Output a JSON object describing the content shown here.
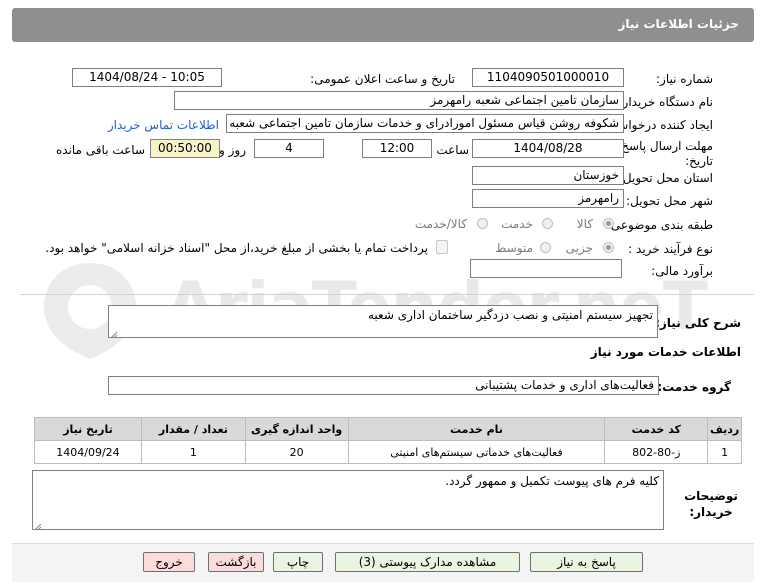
{
  "header": {
    "title": "جزئیات اطلاعات نیاز"
  },
  "watermark": "AriaTender.neT",
  "fields": {
    "need_number": {
      "label": "شماره نیاز:",
      "value": "1104090501000010"
    },
    "announce": {
      "label": "تاریخ و ساعت اعلان عمومی:",
      "value": "1404/08/24 - 10:05"
    },
    "buyer_org": {
      "label": "نام دستگاه خریدار:",
      "value": "سازمان تامین اجتماعی شعبه رامهرمز"
    },
    "requester": {
      "label": "ایجاد کننده درخواست:",
      "value": "شکوفه روشن قیاس مسئول امورادرای و خدمات سازمان تامین اجتماعی شعبه ر",
      "contact_link": "اطلاعات تماس خریدار"
    },
    "deadline": {
      "label": "مهلت ارسال پاسخ: تا تاریخ:",
      "date": "1404/08/28",
      "time_label": "ساعت",
      "time": "12:00",
      "days": "4",
      "days_label": "روز و",
      "remaining": "00:50:00",
      "remaining_label": "ساعت باقی مانده"
    },
    "province": {
      "label": "استان محل تحویل:",
      "value": "خوزستان"
    },
    "city": {
      "label": "شهر محل تحویل:",
      "value": "رامهرمز"
    },
    "category": {
      "label": "طبقه بندی موضوعی:",
      "options": [
        "کالا",
        "خدمت",
        "کالا/خدمت"
      ],
      "selected": "کالا"
    },
    "purchase_type": {
      "label": "نوع فرآیند خرید :",
      "options": [
        "جزیی",
        "متوسط"
      ],
      "selected": "جزیی",
      "payment_note": "پرداخت تمام یا بخشی از مبلغ خرید،از محل \"اسناد خزانه اسلامی\" خواهد بود."
    },
    "estimate": {
      "label": "برآورد مالی:",
      "value": ""
    }
  },
  "summary": {
    "label": "شرح کلی نیاز:",
    "value": "تجهیز سیستم امنیتی و نصب دزدگیر ساختمان اداری شعبه"
  },
  "services_title": "اطلاعات خدمات مورد نیاز",
  "service_group": {
    "label": "گروه خدمت:",
    "value": "فعالیت‌های اداری و خدمات پشتیبانی"
  },
  "table": {
    "headers": [
      "ردیف",
      "کد خدمت",
      "نام خدمت",
      "واحد اندازه گیری",
      "تعداد / مقدار",
      "تاریخ نیاز"
    ],
    "rows": [
      [
        "1",
        "ز-80-802",
        "فعالیت‌های خدماتی سیستم‌های امنیتی",
        "20",
        "1",
        "1404/09/24"
      ]
    ]
  },
  "buyer_notes": {
    "label": "توضیحات خریدار:",
    "value": "کلیه  فرم های پیوست تکمیل و ممهور گردد."
  },
  "buttons": {
    "reply": "پاسخ به نیاز",
    "attachments": "مشاهده مدارک پیوستی (3)",
    "print": "چاپ",
    "back": "بازگشت",
    "exit": "خروج"
  }
}
